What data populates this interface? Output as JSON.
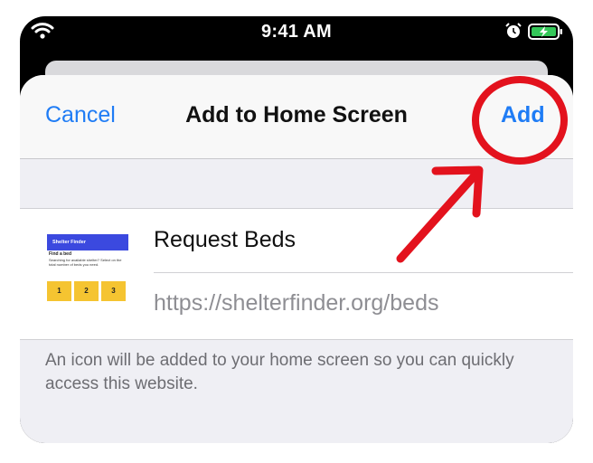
{
  "status_bar": {
    "time": "9:41 AM",
    "icons": [
      "wifi-icon",
      "alarm-icon",
      "battery-charging-icon"
    ]
  },
  "nav": {
    "cancel_label": "Cancel",
    "title": "Add to Home Screen",
    "add_label": "Add"
  },
  "shortcut": {
    "name": "Request Beds",
    "url": "https://shelterfinder.org/beds",
    "thumbnail": {
      "app_name": "Shelter Finder",
      "heading": "Find a bed",
      "text": "Searching for available shelter? Select on the total number of beds you need.",
      "buttons": [
        "1",
        "2",
        "3"
      ]
    }
  },
  "footer_note": "An icon will be added to your home screen so you can quickly access this website.",
  "colors": {
    "accent": "#1f7cf5",
    "annotation": "#e3121d",
    "battery": "#34c759",
    "thumb_header": "#3b49df",
    "thumb_button": "#f5c431"
  }
}
